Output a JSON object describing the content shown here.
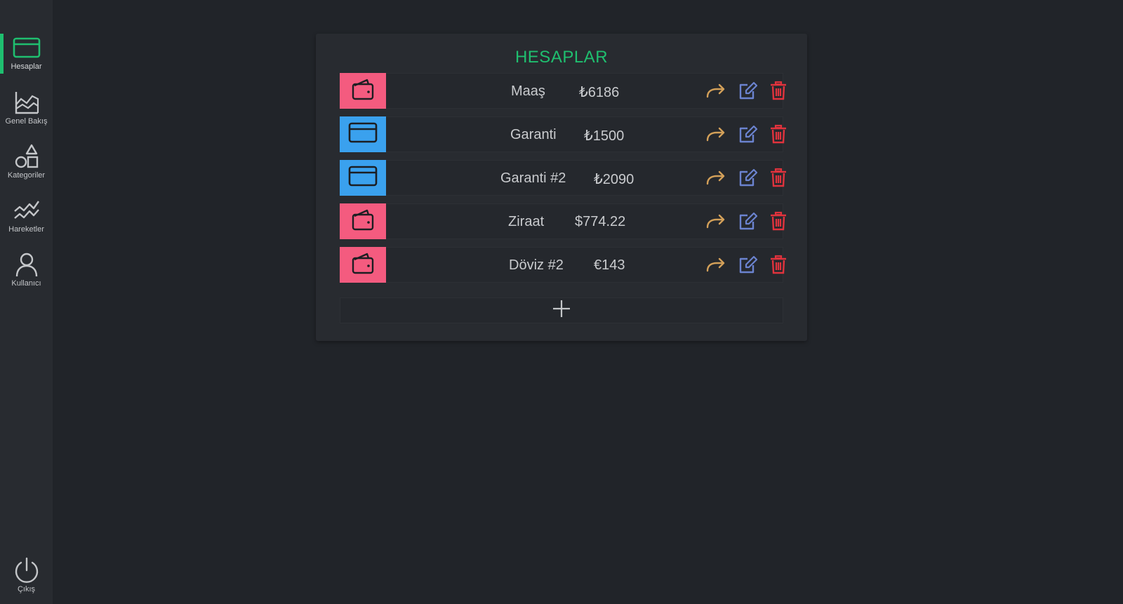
{
  "sidebar": {
    "items": [
      {
        "label": "Hesaplar",
        "icon": "credit-card-icon",
        "active": true
      },
      {
        "label": "Genel Bakış",
        "icon": "area-chart-icon",
        "active": false
      },
      {
        "label": "Kategoriler",
        "icon": "shapes-icon",
        "active": false
      },
      {
        "label": "Hareketler",
        "icon": "activity-lines-icon",
        "active": false
      },
      {
        "label": "Kullanıcı",
        "icon": "user-icon",
        "active": false
      }
    ],
    "logout": {
      "label": "Çıkış",
      "icon": "power-icon"
    }
  },
  "panel": {
    "title": "HESAPLAR",
    "accounts": [
      {
        "name": "Maaş",
        "amount": "₺6186",
        "icon": "wallet-icon",
        "color": "#f45b7f"
      },
      {
        "name": "Garanti",
        "amount": "₺1500",
        "icon": "credit-card-icon",
        "color": "#3aa1ee"
      },
      {
        "name": "Garanti #2",
        "amount": "₺2090",
        "icon": "credit-card-icon",
        "color": "#3aa1ee"
      },
      {
        "name": "Ziraat",
        "amount": "$774.22",
        "icon": "wallet-icon",
        "color": "#f45b7f"
      },
      {
        "name": "Döviz #2",
        "amount": "€143",
        "icon": "wallet-icon",
        "color": "#f45b7f"
      }
    ],
    "add_icon": "plus-icon"
  },
  "colors": {
    "accent": "#1fbf6f",
    "transfer": "#d3a059",
    "edit": "#6b83cf",
    "delete": "#e0333d"
  }
}
